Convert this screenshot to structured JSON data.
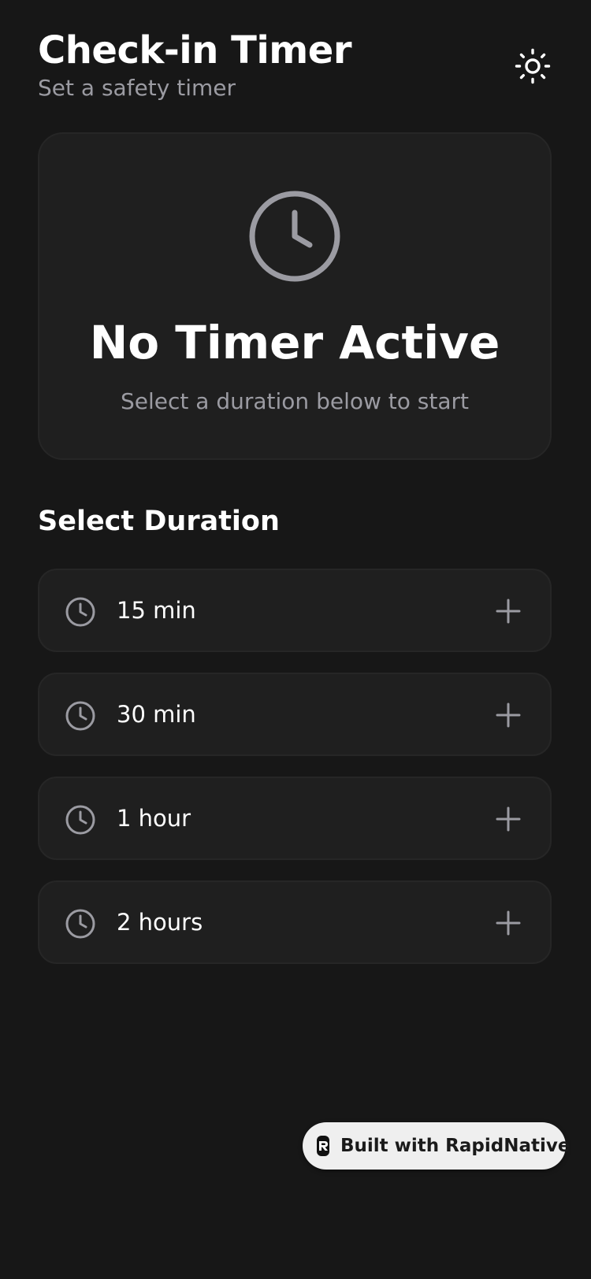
{
  "header": {
    "title": "Check-in Timer",
    "subtitle": "Set a safety timer",
    "theme_toggle_icon": "sun-icon"
  },
  "status": {
    "icon": "clock-icon",
    "title": "No Timer Active",
    "subtitle": "Select a duration below to start"
  },
  "durations": {
    "section_title": "Select Duration",
    "items": [
      {
        "label": "15 min",
        "icon": "clock-icon",
        "action_icon": "plus-icon"
      },
      {
        "label": "30 min",
        "icon": "clock-icon",
        "action_icon": "plus-icon"
      },
      {
        "label": "1 hour",
        "icon": "clock-icon",
        "action_icon": "plus-icon"
      },
      {
        "label": "2 hours",
        "icon": "clock-icon",
        "action_icon": "plus-icon"
      }
    ]
  },
  "badge": {
    "text": "Built with RapidNative",
    "icon": "rapidnative-logo-icon"
  },
  "colors": {
    "background": "#171717",
    "card": "#1f1f1f",
    "card_border": "#262626",
    "text_primary": "#ffffff",
    "text_secondary": "#9b9ba2",
    "badge_background": "#efefef"
  }
}
